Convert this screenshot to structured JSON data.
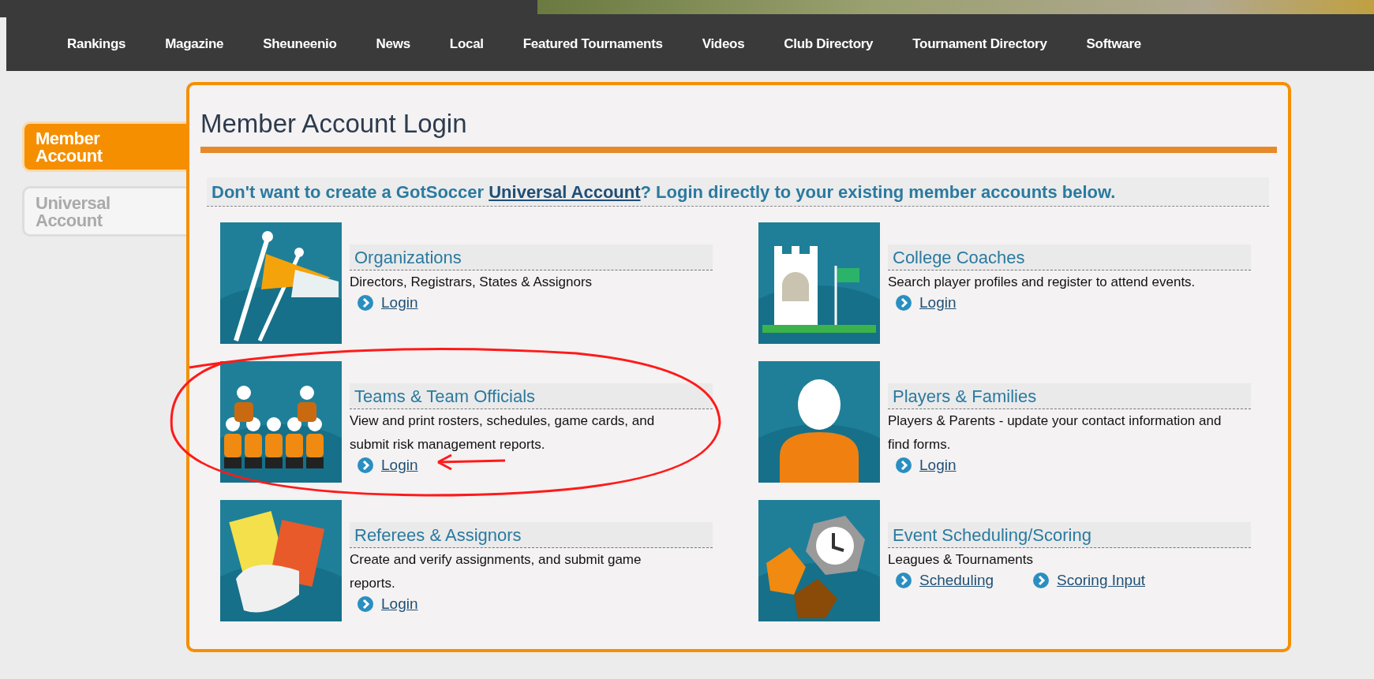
{
  "nav": [
    "Rankings",
    "Magazine",
    "Sheuneenio",
    "News",
    "Local",
    "Featured Tournaments",
    "Videos",
    "Club Directory",
    "Tournament Directory",
    "Software"
  ],
  "side_tabs": [
    {
      "label": "Member Account",
      "selected": true
    },
    {
      "label": "Universal Account",
      "selected": false
    }
  ],
  "title": "Member Account Login",
  "notice": {
    "before": "Don't want to create a GotSoccer ",
    "link": "Universal Account",
    "after": "? Login directly to your existing member accounts below."
  },
  "cards": [
    {
      "kind": "flags",
      "title": "Organizations",
      "description": "Directors, Registrars, States & Assignors",
      "links": [
        "Login"
      ]
    },
    {
      "kind": "tower",
      "title": "College Coaches",
      "description": "Search player profiles and register to attend events.",
      "links": [
        "Login"
      ]
    },
    {
      "kind": "team",
      "title": "Teams & Team Officials",
      "description": "View and print rosters, schedules, game cards, and submit risk management reports.",
      "links": [
        "Login"
      ]
    },
    {
      "kind": "player",
      "title": "Players & Families",
      "description": "Players & Parents - update your contact information and find forms.",
      "links": [
        "Login"
      ]
    },
    {
      "kind": "referee",
      "title": "Referees & Assignors",
      "description": "Create and verify assignments, and submit game reports.",
      "links": [
        "Login"
      ]
    },
    {
      "kind": "clock",
      "title": "Event Scheduling/Scoring",
      "description": "Leagues & Tournaments",
      "links": [
        "Scheduling",
        "Scoring Input"
      ]
    }
  ]
}
